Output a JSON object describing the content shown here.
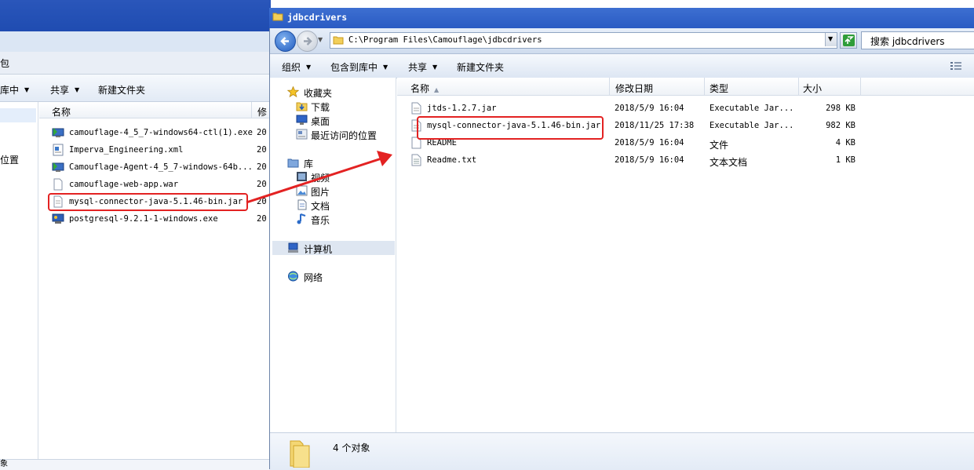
{
  "background_window": {
    "address_fragment": "包",
    "commands": {
      "include_in_library": "库中",
      "share": "共享",
      "new_folder": "新建文件夹"
    },
    "nav_fragment": "位置",
    "columns": {
      "name": "名称",
      "date_fragment": "修"
    },
    "files": [
      {
        "name": "camouflage-4_5_7-windows64-ctl(1).exe",
        "date_fragment": "20",
        "icon": "installer-icon"
      },
      {
        "name": "Imperva_Engineering.xml",
        "date_fragment": "20",
        "icon": "xml-icon"
      },
      {
        "name": "Camouflage-Agent-4_5_7-windows-64b...",
        "date_fragment": "20",
        "icon": "installer-icon"
      },
      {
        "name": "camouflage-web-app.war",
        "date_fragment": "20",
        "icon": "file-icon"
      },
      {
        "name": "mysql-connector-java-5.1.46-bin.jar",
        "date_fragment": "20",
        "icon": "jar-icon"
      },
      {
        "name": "postgresql-9.2.1-1-windows.exe",
        "date_fragment": "20",
        "icon": "pg-installer-icon"
      }
    ],
    "status_fragment": "象"
  },
  "foreground_window": {
    "title": "jdbcdrivers",
    "address": "C:\\Program Files\\Camouflage\\jdbcdrivers",
    "search_placeholder": "搜索 jdbcdrivers",
    "commands": {
      "organize": "组织",
      "include_in_library": "包含到库中",
      "share": "共享",
      "new_folder": "新建文件夹"
    },
    "nav": {
      "favorites": "收藏夹",
      "downloads": "下载",
      "desktop": "桌面",
      "recent_places": "最近访问的位置",
      "libraries": "库",
      "videos": "视频",
      "pictures": "图片",
      "documents": "文档",
      "music": "音乐",
      "computer": "计算机",
      "network": "网络"
    },
    "columns": {
      "name": "名称",
      "date": "修改日期",
      "type": "类型",
      "size": "大小"
    },
    "files": [
      {
        "name": "jtds-1.2.7.jar",
        "date": "2018/5/9 16:04",
        "type": "Executable Jar...",
        "size": "298 KB",
        "icon": "jar-icon"
      },
      {
        "name": "mysql-connector-java-5.1.46-bin.jar",
        "date": "2018/11/25 17:38",
        "type": "Executable Jar...",
        "size": "982 KB",
        "icon": "jar-icon"
      },
      {
        "name": "README",
        "date": "2018/5/9 16:04",
        "type": "文件",
        "size": "4 KB",
        "icon": "file-icon"
      },
      {
        "name": "Readme.txt",
        "date": "2018/5/9 16:04",
        "type": "文本文档",
        "size": "1 KB",
        "icon": "text-file-icon"
      }
    ],
    "details": "4 个对象"
  },
  "colors": {
    "highlight": "#e32222",
    "title_bar": "#2a5bc3"
  }
}
